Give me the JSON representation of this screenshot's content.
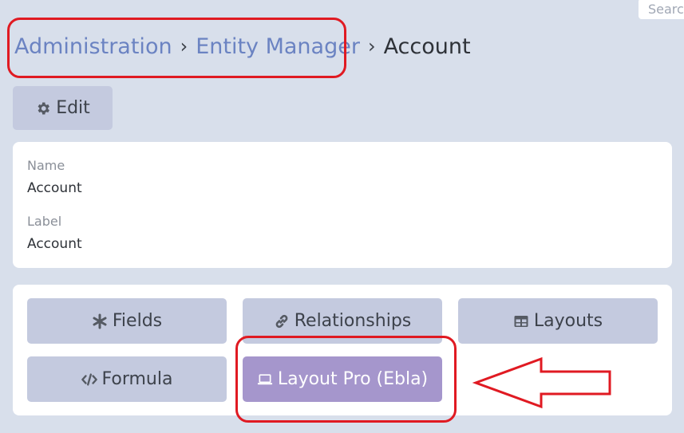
{
  "search": {
    "placeholder_text": "Searc"
  },
  "breadcrumb": {
    "items": [
      "Administration",
      "Entity Manager"
    ],
    "separator": "›",
    "current": "Account"
  },
  "edit_button": {
    "label": "Edit",
    "icon": "gear-icon"
  },
  "details": {
    "name_label": "Name",
    "name_value": "Account",
    "label_label": "Label",
    "label_value": "Account"
  },
  "actions": [
    {
      "label": "Fields",
      "icon": "asterisk-icon"
    },
    {
      "label": "Relationships",
      "icon": "link-icon"
    },
    {
      "label": "Layouts",
      "icon": "table-icon"
    },
    {
      "label": "Formula",
      "icon": "code-icon"
    },
    {
      "label": "Layout Pro (Ebla)",
      "icon": "laptop-icon"
    }
  ],
  "colors": {
    "background": "#d8dfeb",
    "button": "#c4cadf",
    "active_button": "#a596cc",
    "link": "#6b83c2",
    "annotation": "#e01a22"
  }
}
